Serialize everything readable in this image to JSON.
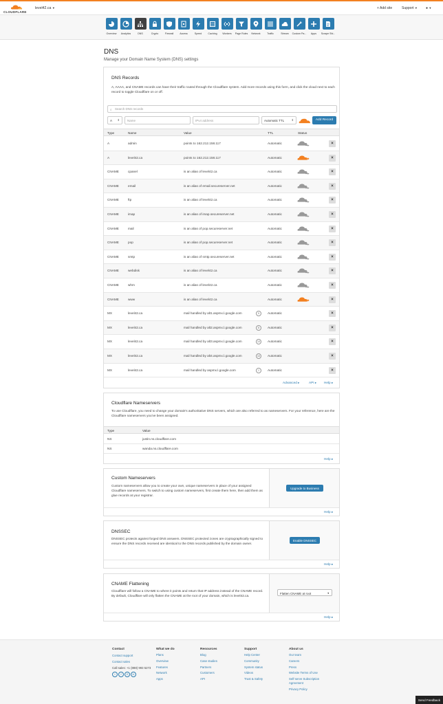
{
  "header": {
    "brand": "CLOUDFLARE",
    "domain": "level42.ca",
    "add_site": "+ Add site",
    "support": "Support",
    "brand_color": "#f38020"
  },
  "nav": [
    {
      "label": "Overview",
      "icon": "overview-icon"
    },
    {
      "label": "Analytics",
      "icon": "analytics-icon"
    },
    {
      "label": "DNS",
      "icon": "dns-icon",
      "active": true
    },
    {
      "label": "Crypto",
      "icon": "lock-icon"
    },
    {
      "label": "Firewall",
      "icon": "shield-icon"
    },
    {
      "label": "Access",
      "icon": "access-icon"
    },
    {
      "label": "Speed",
      "icon": "lightning-icon"
    },
    {
      "label": "Caching",
      "icon": "caching-icon"
    },
    {
      "label": "Workers",
      "icon": "workers-icon"
    },
    {
      "label": "Page Rules",
      "icon": "filter-icon"
    },
    {
      "label": "Network",
      "icon": "location-icon"
    },
    {
      "label": "Traffic",
      "icon": "list-icon"
    },
    {
      "label": "Stream",
      "icon": "cloud-upload-icon"
    },
    {
      "label": "Custom Pa...",
      "icon": "wrench-icon"
    },
    {
      "label": "Apps",
      "icon": "plus-icon"
    },
    {
      "label": "Scrape Shi...",
      "icon": "document-icon"
    }
  ],
  "page": {
    "title": "DNS",
    "subtitle": "Manage your Domain Name System (DNS) settings"
  },
  "records": {
    "title": "DNS Records",
    "description": "A, AAAA, and CNAME records can have their traffic routed through the Cloudflare system. Add more records using this form, and click the cloud next to each record to toggle Cloudflare on or off.",
    "search_placeholder": "Search DNS records",
    "type_value": "A",
    "name_placeholder": "Name",
    "value_placeholder": "IPv4 address",
    "ttl_value": "Automatic TTL",
    "add_button": "Add Record",
    "columns": [
      "Type",
      "Name",
      "Value",
      "TTL",
      "Status"
    ],
    "rows": [
      {
        "type": "A",
        "name": "admin",
        "value": "points to 162.212.158.117",
        "ttl": "Automatic",
        "proxied": false
      },
      {
        "type": "A",
        "name": "level42.ca",
        "value": "points to 162.212.158.117",
        "ttl": "Automatic",
        "proxied": true
      },
      {
        "type": "CNAME",
        "name": "cpanel",
        "value": "is an alias of level42.ca",
        "ttl": "Automatic",
        "proxied": false
      },
      {
        "type": "CNAME",
        "name": "email",
        "value": "is an alias of email.secureserver.net",
        "ttl": "Automatic",
        "proxied": false
      },
      {
        "type": "CNAME",
        "name": "ftp",
        "value": "is an alias of level42.ca",
        "ttl": "Automatic",
        "proxied": false
      },
      {
        "type": "CNAME",
        "name": "imap",
        "value": "is an alias of imap.secureserver.net",
        "ttl": "Automatic",
        "proxied": false
      },
      {
        "type": "CNAME",
        "name": "mail",
        "value": "is an alias of pop.secureserver.net",
        "ttl": "Automatic",
        "proxied": false
      },
      {
        "type": "CNAME",
        "name": "pop",
        "value": "is an alias of pop.secureserver.net",
        "ttl": "Automatic",
        "proxied": false
      },
      {
        "type": "CNAME",
        "name": "smtp",
        "value": "is an alias of smtp.secureserver.net",
        "ttl": "Automatic",
        "proxied": false
      },
      {
        "type": "CNAME",
        "name": "webdisk",
        "value": "is an alias of level42.ca",
        "ttl": "Automatic",
        "proxied": false
      },
      {
        "type": "CNAME",
        "name": "whm",
        "value": "is an alias of level42.ca",
        "ttl": "Automatic",
        "proxied": false
      },
      {
        "type": "CNAME",
        "name": "www",
        "value": "is an alias of level42.ca",
        "ttl": "Automatic",
        "proxied": true
      },
      {
        "type": "MX",
        "name": "level42.ca",
        "value": "mail handled by alt1.aspmx.l.google.com",
        "ttl": "Automatic",
        "priority": "5"
      },
      {
        "type": "MX",
        "name": "level42.ca",
        "value": "mail handled by alt2.aspmx.l.google.com",
        "ttl": "Automatic",
        "priority": "5"
      },
      {
        "type": "MX",
        "name": "level42.ca",
        "value": "mail handled by alt3.aspmx.l.google.com",
        "ttl": "Automatic",
        "priority": "10"
      },
      {
        "type": "MX",
        "name": "level42.ca",
        "value": "mail handled by alt4.aspmx.l.google.com",
        "ttl": "Automatic",
        "priority": "10"
      },
      {
        "type": "MX",
        "name": "level42.ca",
        "value": "mail handled by aspmx.l.google.com",
        "ttl": "Automatic",
        "priority": "1"
      }
    ],
    "footer_links": {
      "advanced": "Advanced ▸",
      "api": "API ▸",
      "help": "Help ▸"
    }
  },
  "nameservers": {
    "title": "Cloudflare Nameservers",
    "description": "To use Cloudflare, you need to change your domain's authoritative DNS servers, which are also referred to as nameservers. For your reference, here are the Cloudflare nameservers you've been assigned.",
    "columns": [
      "Type",
      "Value"
    ],
    "rows": [
      {
        "type": "NS",
        "value": "justin.ns.cloudflare.com"
      },
      {
        "type": "NS",
        "value": "wanda.ns.cloudflare.com"
      }
    ],
    "help": "Help ▸"
  },
  "custom_ns": {
    "title": "Custom Nameservers",
    "description": "Custom nameservers allow you to create your own, unique nameservers in place of your assigned Cloudflare nameservers. To switch to using custom nameservers, first create them here, then add them as glue records at your registrar.",
    "button": "Upgrade to Business",
    "help": "Help ▸"
  },
  "dnssec": {
    "title": "DNSSEC",
    "description": "DNSSEC protects against forged DNS answers. DNSSEC protected zones are cryptographically signed to ensure the DNS records received are identical to the DNS records published by the domain owner.",
    "button": "Enable DNSSEC",
    "help": "Help ▸"
  },
  "cname_flat": {
    "title": "CNAME Flattening",
    "description": "Cloudflare will follow a CNAME to where it points and return that IP address instead of the CNAME record. By default, Cloudflare will only flatten the CNAME at the root of your domain, which is level42.ca.",
    "select_value": "Flatten CNAME at root",
    "help": "Help ▸"
  },
  "footer": {
    "contact": {
      "title": "Contact",
      "links": [
        "Contact support",
        "Contact sales"
      ],
      "phone": "Call sales: +1 (888) 993 5273"
    },
    "what_we_do": {
      "title": "What we do",
      "links": [
        "Plans",
        "Overview",
        "Features",
        "Network",
        "Apps"
      ]
    },
    "resources": {
      "title": "Resources",
      "links": [
        "Blog",
        "Case studies",
        "Partners",
        "Customers",
        "API"
      ]
    },
    "support": {
      "title": "Support",
      "links": [
        "Help Center",
        "Community",
        "System status",
        "Videos",
        "Trust & Safety"
      ]
    },
    "about": {
      "title": "About us",
      "links": [
        "Our team",
        "Careers",
        "Press",
        "Website Terms of Use",
        "Self-serve Subscription Agreement",
        "Privacy Policy"
      ]
    },
    "send_feedback": "Send Feedback"
  }
}
